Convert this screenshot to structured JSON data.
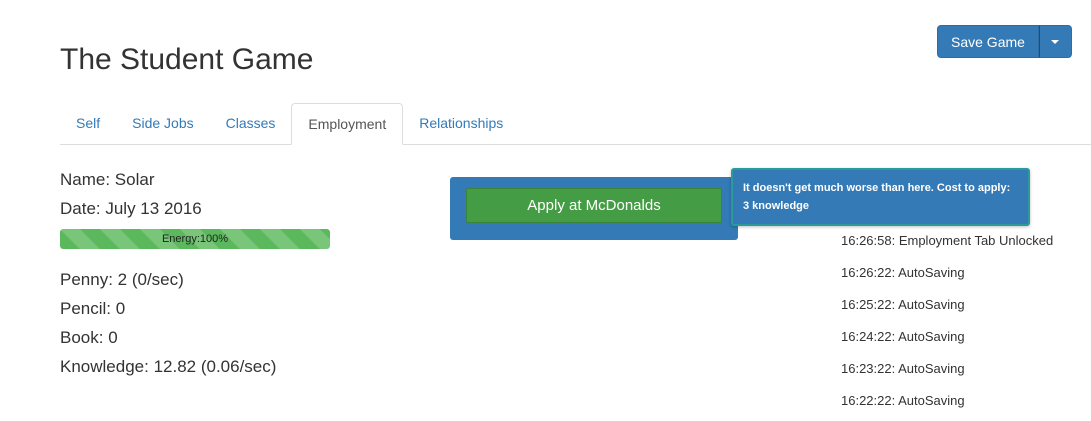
{
  "header": {
    "title": "The Student Game",
    "save_label": "Save Game",
    "save_caret_icon": "caret-down-icon"
  },
  "tabs": [
    {
      "label": "Self",
      "active": false
    },
    {
      "label": "Side Jobs",
      "active": false
    },
    {
      "label": "Classes",
      "active": false
    },
    {
      "label": "Employment",
      "active": true
    },
    {
      "label": "Relationships",
      "active": false
    }
  ],
  "stats": {
    "name": "Name: Solar",
    "date": "Date: July 13 2016",
    "energy_label": "Energy:100%",
    "energy_fraction": 1.0,
    "penny": "Penny: 2 (0/sec)",
    "pencil": "Pencil: 0",
    "book": "Book: 0",
    "knowledge": "Knowledge: 12.82 (0.06/sec)"
  },
  "job": {
    "apply_label": "Apply at McDonalds",
    "tooltip_line1": "It doesn't get much worse than here. Cost to apply:",
    "tooltip_line2": "3 knowledge"
  },
  "log": [
    "16:26:58: Employment Tab Unlocked",
    "16:26:22: AutoSaving",
    "16:25:22: AutoSaving",
    "16:24:22: AutoSaving",
    "16:23:22: AutoSaving",
    "16:22:22: AutoSaving"
  ],
  "colors": {
    "primary": "#337ab7",
    "success": "#5cb85c",
    "apply_button": "#449d44"
  }
}
